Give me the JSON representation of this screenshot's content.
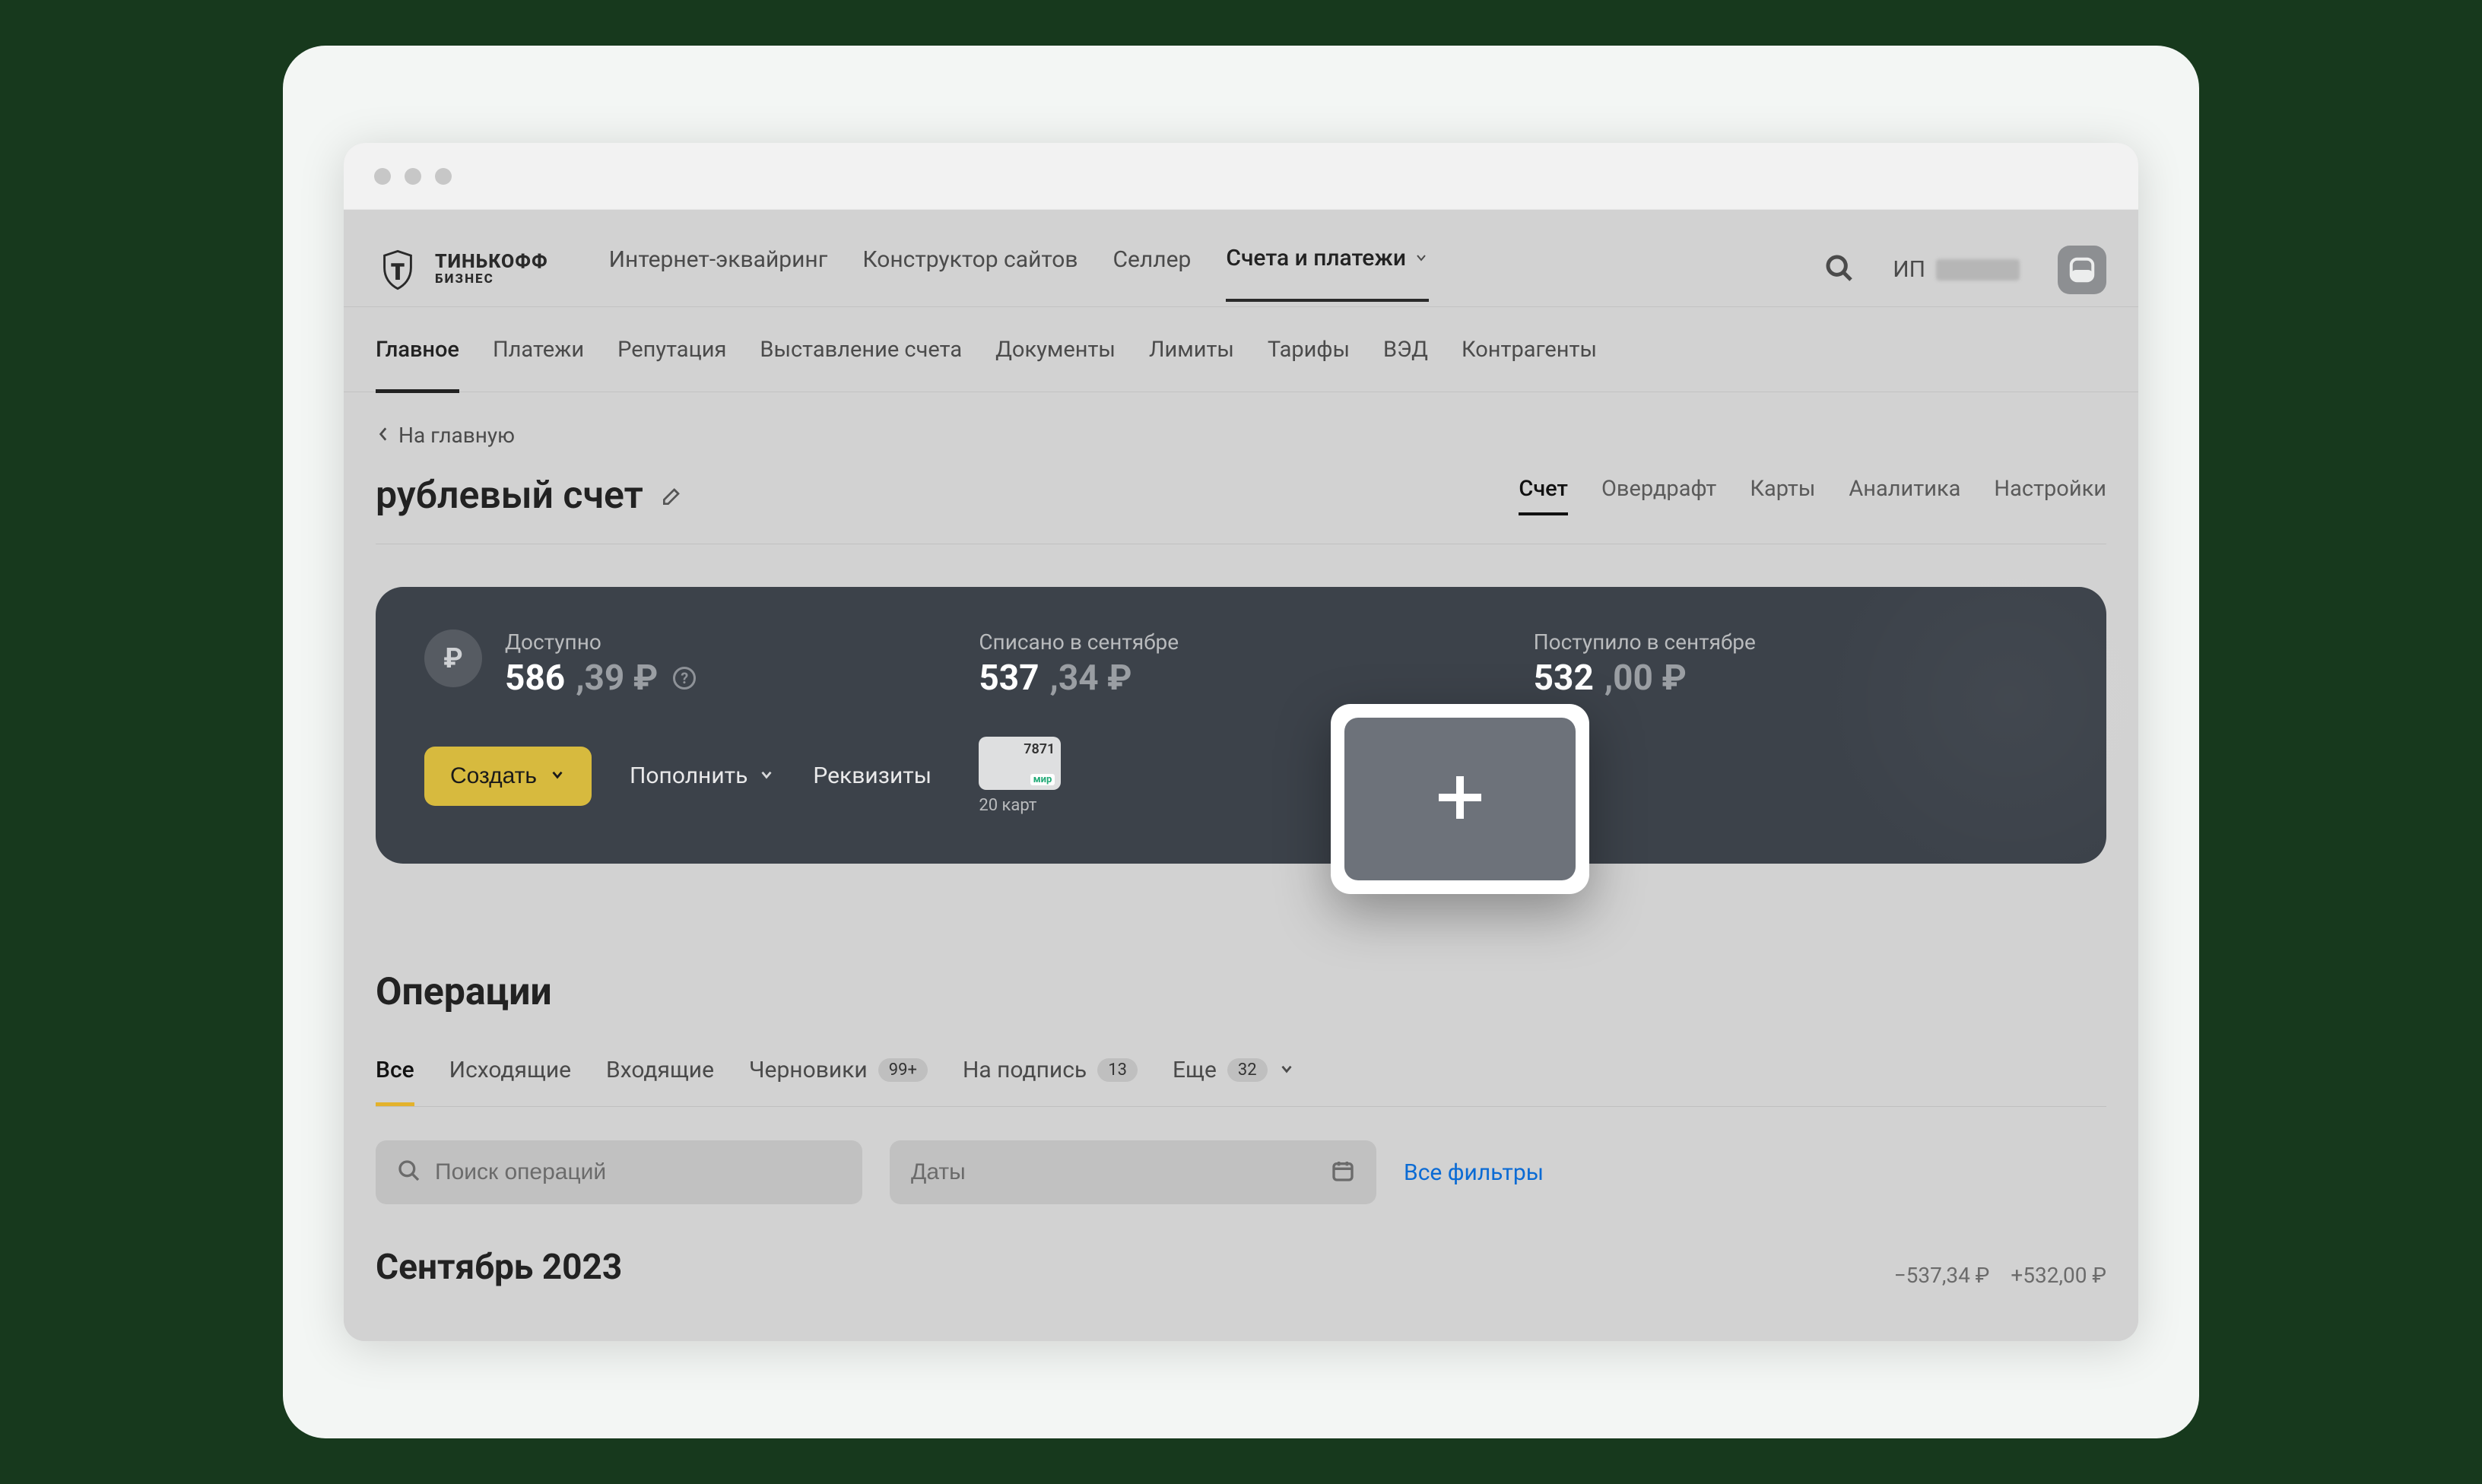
{
  "brand": {
    "line1": "ТИНЬКОФФ",
    "line2": "БИЗНЕС"
  },
  "topnav": {
    "items": [
      "Интернет-эквайринг",
      "Конструктор сайтов",
      "Селлер",
      "Счета и платежи"
    ],
    "activeIndex": 3,
    "userPrefix": "ИП"
  },
  "subnav": {
    "items": [
      "Главное",
      "Платежи",
      "Репутация",
      "Выставление счета",
      "Документы",
      "Лимиты",
      "Тарифы",
      "ВЭД",
      "Контрагенты"
    ],
    "activeIndex": 0
  },
  "back": "На главную",
  "title": "рублевый счет",
  "titleTabs": {
    "items": [
      "Счет",
      "Овердрафт",
      "Карты",
      "Аналитика",
      "Настройки"
    ],
    "activeIndex": 0
  },
  "panel": {
    "available": {
      "label": "Доступно",
      "int": "586",
      "frac": ",39 ₽"
    },
    "out": {
      "label": "Списано в сентябре",
      "int": "537",
      "frac": ",34 ₽"
    },
    "in": {
      "label": "Поступило в сентябре",
      "int": "532",
      "frac": ",00 ₽"
    },
    "create": "Создать",
    "topup": "Пополнить",
    "details": "Реквизиты",
    "cardLast4": "7871",
    "cardSystem": "мир",
    "cardsCount": "20 карт"
  },
  "ops": {
    "title": "Операции",
    "tabs": {
      "all": "Все",
      "out": "Исходящие",
      "in": "Входящие",
      "drafts": "Черновики",
      "draftsBadge": "99+",
      "sign": "На подпись",
      "signBadge": "13",
      "more": "Еще",
      "moreBadge": "32"
    },
    "searchPlaceholder": "Поиск операций",
    "datesPlaceholder": "Даты",
    "allFilters": "Все фильтры",
    "monthTitle": "Сентябрь 2023",
    "monthOut": "−537,34 ₽",
    "monthIn": "+532,00 ₽"
  }
}
